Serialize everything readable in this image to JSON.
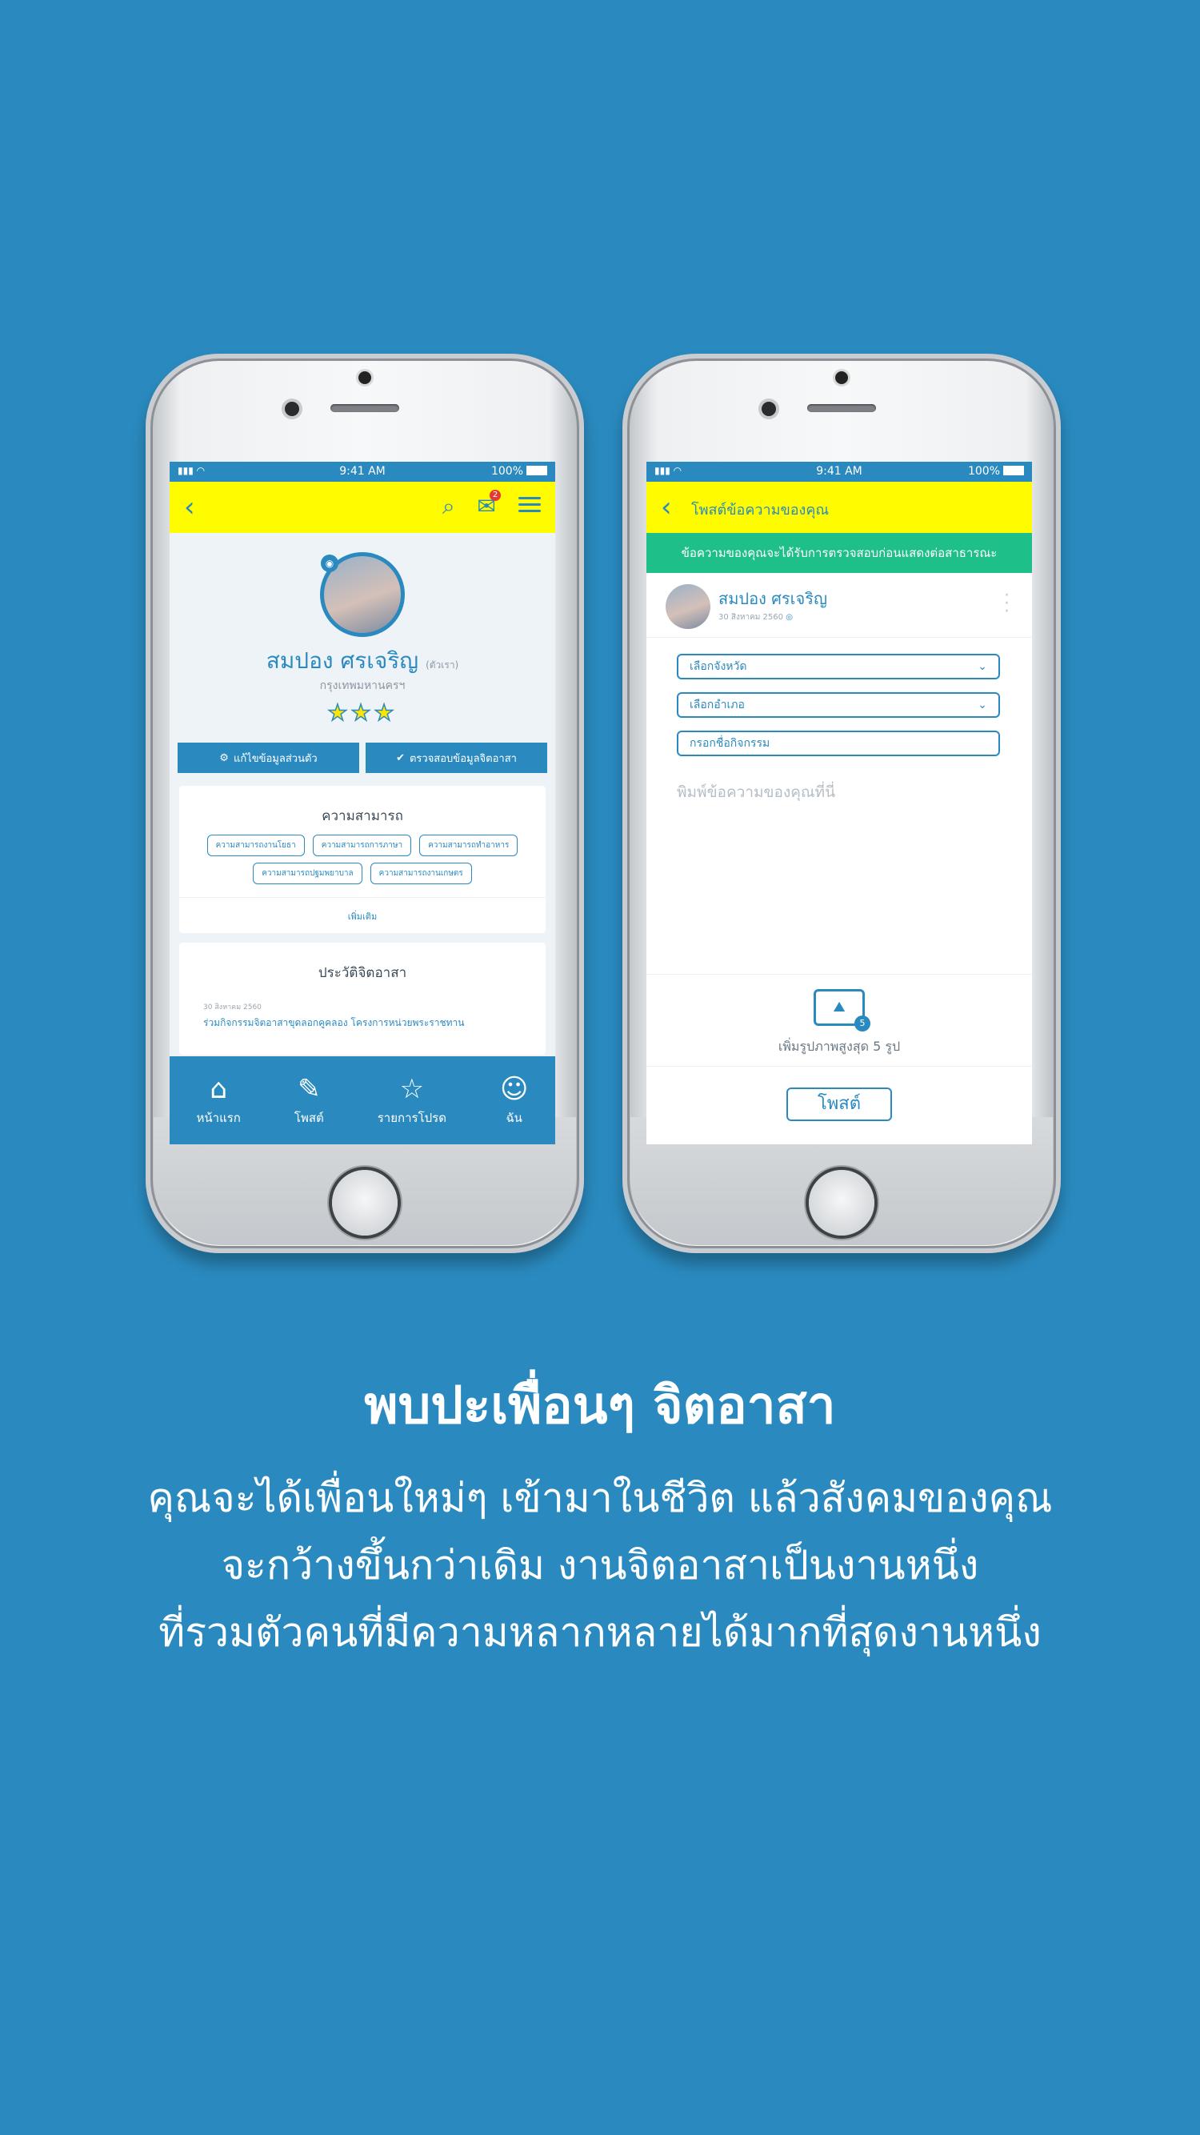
{
  "status": {
    "time": "9:41 AM",
    "battery": "100%"
  },
  "left": {
    "notif_count": "2",
    "name": "สมปอง ศรเจริญ",
    "name_tag": "(ตัวเรา)",
    "city": "กรุงเทพมหานครฯ",
    "stars": "★★★",
    "btn_edit": "แก้ไขข้อมูลส่วนตัว",
    "btn_verify": "ตรวจสอบข้อมูลจิตอาสา",
    "skills_title": "ความสามารถ",
    "skills": [
      "ความสามารถงานโยธา",
      "ความสามารถการภาษา",
      "ความสามารถทำอาหาร",
      "ความสามารถปฐมพยาบาล",
      "ความสามารถงานเกษตร"
    ],
    "more": "เพิ่มเติม",
    "history_title": "ประวัติจิตอาสา",
    "history_date": "30 สิงหาคม 2560",
    "history_text": "ร่วมกิจกรรมจิตอาสาขุดลอกคูคลอง โครงการหน่วยพระราชทาน",
    "tabs": [
      {
        "label": "หน้าแรก",
        "icon": "⌂"
      },
      {
        "label": "โพสต์",
        "icon": "✎"
      },
      {
        "label": "รายการโปรด",
        "icon": "☆"
      },
      {
        "label": "ฉัน",
        "icon": "☺"
      }
    ]
  },
  "right": {
    "title": "โพสต์ข้อความของคุณ",
    "notice": "ข้อความของคุณจะได้รับการตรวจสอบก่อนแสดงต่อสาธารณะ",
    "name": "สมปอง ศรเจริญ",
    "date": "30 สิงหาคม 2560",
    "province": "เลือกจังหวัด",
    "district": "เลือกอำเภอ",
    "activity": "กรอกชื่อกิจกรรม",
    "message_placeholder": "พิมพ์ข้อความของคุณที่นี่",
    "photo_count": "5",
    "photo_label": "เพิ่มรูปภาพสูงสุด 5 รูป",
    "post": "โพสต์"
  },
  "headline": "พบปะเพื่อนๆ จิตอาสา",
  "body_lines": [
    "คุณจะได้เพื่อนใหม่ๆ เข้ามาในชีวิต แล้วสังคมของคุณ",
    "จะกว้างขึ้นกว่าเดิม งานจิตอาสาเป็นงานหนึ่ง",
    "ที่รวมตัวคนที่มีความหลากหลายได้มากที่สุดงานหนึ่ง"
  ]
}
